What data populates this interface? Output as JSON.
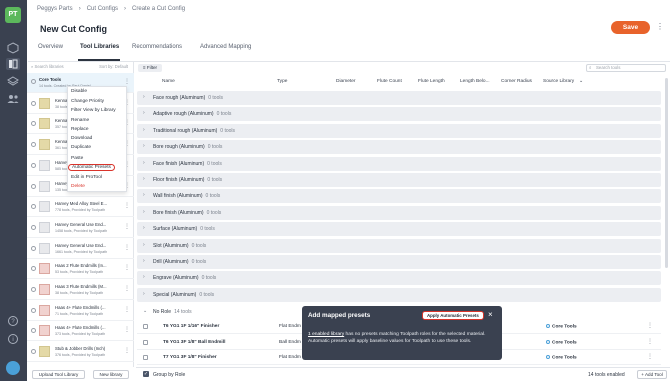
{
  "rail": {
    "logo": "PT",
    "icons": [
      "cube-icon",
      "library-icon",
      "layers-icon",
      "users-icon",
      "help-icon",
      "info-icon"
    ]
  },
  "breadcrumb": [
    "Peggys Parts",
    "Cut Configs",
    "Create a Cut Config"
  ],
  "page_title": "New Cut Config",
  "save_label": "Save",
  "tabs": [
    "Overview",
    "Tool Libraries",
    "Recommendations",
    "Advanced Mapping"
  ],
  "active_tab": "Tool Libraries",
  "libraries": {
    "search_placeholder": "Search libraries",
    "sort_label": "Sort by: Default",
    "items": [
      {
        "name": "Core Tools",
        "sub": "14 tools. Created by Paul Daniel",
        "thumb": "none"
      },
      {
        "name": "Kennametal Drills",
        "sub": "38 tools",
        "thumb": "yellow"
      },
      {
        "name": "Kennametal Endmills",
        "sub": "357 tools",
        "thumb": "yellow"
      },
      {
        "name": "Kennametal Inserts",
        "sub": "361 tools",
        "thumb": "yellow"
      },
      {
        "name": "Harvey Ball",
        "sub": "585 tools",
        "thumb": "grey"
      },
      {
        "name": "Harvey Chamfer",
        "sub": "135 tools",
        "thumb": "grey"
      },
      {
        "name": "Harvey Med Alloy Steel E...",
        "sub": "778 tools, Provided by Toolpath",
        "thumb": "grey"
      },
      {
        "name": "Harvey General Use End...",
        "sub": "1458 tools, Provided by Toolpath",
        "thumb": "grey"
      },
      {
        "name": "Harvey General Use End...",
        "sub": "1661 tools, Provided by Toolpath",
        "thumb": "grey"
      },
      {
        "name": "Haas 2 Flute Endmills (In...",
        "sub": "53 tools, Provided by Toolpath",
        "thumb": "red"
      },
      {
        "name": "Haas 3 Flute Endmills (M...",
        "sub": "38 tools, Provided by Toolpath",
        "thumb": "red"
      },
      {
        "name": "Haas 4+ Flute Endmills (...",
        "sub": "71 tools, Provided by Toolpath",
        "thumb": "red"
      },
      {
        "name": "Haas 4+ Flute Endmills (...",
        "sub": "373 tools, Provided by Toolpath",
        "thumb": "red"
      },
      {
        "name": "Stub & Jobber Drills (Inch)",
        "sub": "376 tools, Provided by Toolpath",
        "thumb": "yellow"
      }
    ],
    "upload_label": "Upload Tool Library",
    "new_label": "New library"
  },
  "context_menu": [
    "Disable",
    "Change Priority",
    "Filter View by Library",
    "Rename",
    "Replace",
    "Download",
    "Duplicate",
    "Paste",
    "Automatic Presets",
    "Edit in ProTool",
    "Delete"
  ],
  "context_menu_highlight": "Automatic Presets",
  "filter_label": "Filter",
  "tool_search_placeholder": "Search tools",
  "columns": [
    "Name",
    "Type",
    "Diameter",
    "Flute Count",
    "Flute Length",
    "Length Belo...",
    "Corner Radius",
    "Source Library"
  ],
  "groups": [
    {
      "label": "Face rough (Aluminum)",
      "count": "0 tools"
    },
    {
      "label": "Adaptive rough (Aluminum)",
      "count": "0 tools"
    },
    {
      "label": "Traditional rough (Aluminum)",
      "count": "0 tools"
    },
    {
      "label": "Bore rough (Aluminum)",
      "count": "0 tools"
    },
    {
      "label": "Face finish (Aluminum)",
      "count": "0 tools"
    },
    {
      "label": "Floor finish (Aluminum)",
      "count": "0 tools"
    },
    {
      "label": "Wall finish (Aluminum)",
      "count": "0 tools"
    },
    {
      "label": "Bore finish (Aluminum)",
      "count": "0 tools"
    },
    {
      "label": "Surface (Aluminum)",
      "count": "0 tools"
    },
    {
      "label": "Slot (Aluminum)",
      "count": "0 tools"
    },
    {
      "label": "Drill (Aluminum)",
      "count": "0 tools"
    },
    {
      "label": "Engrave (Aluminum)",
      "count": "0 tools"
    },
    {
      "label": "Special (Aluminum)",
      "count": "0 tools"
    }
  ],
  "no_role": {
    "label": "No Role",
    "count": "14 tools"
  },
  "tool_rows": [
    {
      "name": "T6 YG1 1F 1/16\" Finisher",
      "type": "Flat Endm",
      "source": "Core Tools"
    },
    {
      "name": "T6 YG1 3F 1/8\" Ball Endmill",
      "type": "Ball Endm",
      "source": "Core Tools"
    },
    {
      "name": "T7 YG1 3F 1/8\" Finisher",
      "type": "Flat Endm",
      "source": "Core Tools"
    }
  ],
  "toast": {
    "title": "Add mapped presets",
    "button": "Apply Automatic Presets",
    "link": "1 enabled library",
    "message": " has no presets matching Toolpath roles for the selected material. Automatic presets will apply baseline values for Toolpath to use these tools."
  },
  "bottom": {
    "group_by_role": "Group by Role",
    "enabled": "14 tools enabled",
    "add_tool": "+ Add Tool"
  }
}
